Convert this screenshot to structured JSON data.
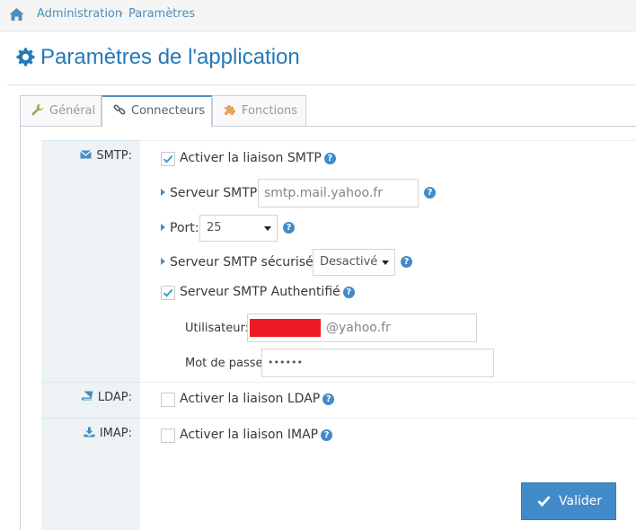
{
  "breadcrumb": {
    "items": [
      "Administration",
      "Paramètres"
    ],
    "separator": "›"
  },
  "page": {
    "title": "Paramètres de l'application"
  },
  "tabs": [
    {
      "label": "Général",
      "icon": "wrench-icon",
      "active": false
    },
    {
      "label": "Connecteurs",
      "icon": "link-icon",
      "active": true
    },
    {
      "label": "Fonctions",
      "icon": "puzzle-icon",
      "active": false
    }
  ],
  "smtp": {
    "section_label": "SMTP:",
    "enable_label": "Activer la liaison SMTP",
    "enable_checked": true,
    "server_label": "Serveur SMTP:",
    "server_value": "smtp.mail.yahoo.fr",
    "port_label": "Port:",
    "port_value": "25",
    "secure_label": "Serveur SMTP sécurisé:",
    "secure_value": "Desactivé",
    "auth_label": "Serveur SMTP Authentifié",
    "auth_checked": true,
    "user_label": "Utilisateur:",
    "user_suffix": "@yahoo.fr",
    "password_label": "Mot de passe:",
    "password_value": "••••••"
  },
  "ldap": {
    "section_label": "LDAP:",
    "enable_label": "Activer la liaison LDAP",
    "enable_checked": false
  },
  "imap": {
    "section_label": "IMAP:",
    "enable_label": "Activer la liaison IMAP",
    "enable_checked": false
  },
  "actions": {
    "submit_label": "Valider"
  },
  "help_glyph": "?",
  "colors": {
    "accent": "#2679b5",
    "link": "#4c8fbd",
    "button": "#428bca",
    "redaction": "#ed1c24"
  }
}
